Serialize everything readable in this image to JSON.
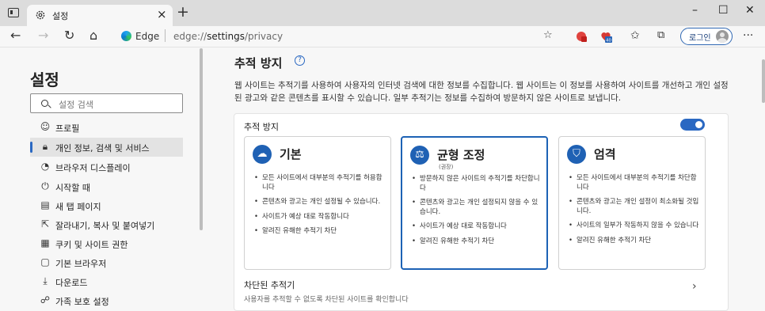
{
  "tab": {
    "title": "설정",
    "close": "×",
    "new_tab": "+"
  },
  "window_controls": {
    "minimize": "–",
    "maximize": "☐",
    "close": "✕"
  },
  "toolbar": {
    "back": "←",
    "forward": "→",
    "refresh": "↻",
    "home": "⌂",
    "edge_label": "Edge",
    "url_prefix": "edge://",
    "url_path": "settings",
    "url_suffix": "/privacy",
    "ext_badge": "40",
    "login": "로그인",
    "more": "···"
  },
  "sidebar": {
    "title": "설정",
    "search_placeholder": "설정 검색",
    "items": [
      {
        "label": "프로필",
        "icon": "profile-icon"
      },
      {
        "label": "개인 정보, 검색 및 서비스",
        "icon": "lock-icon"
      },
      {
        "label": "브라우저 디스플레이",
        "icon": "palette-icon"
      },
      {
        "label": "시작할 때",
        "icon": "power-icon"
      },
      {
        "label": "새 탭 페이지",
        "icon": "new-tab-page-icon"
      },
      {
        "label": "잘라내기, 복사 및 붙여넣기",
        "icon": "share-icon"
      },
      {
        "label": "쿠키 및 사이트 권한",
        "icon": "cookie-icon"
      },
      {
        "label": "기본 브라우저",
        "icon": "browser-icon"
      },
      {
        "label": "다운로드",
        "icon": "download-icon"
      },
      {
        "label": "가족 보호 설정",
        "icon": "family-icon"
      }
    ]
  },
  "main": {
    "title": "추적 방지",
    "help": "?",
    "description": "웹 사이트는 추적기를 사용하여 사용자의 인터넷 검색에 대한 정보를 수집합니다. 웹 사이트는 이 정보를 사용하여 사이트를 개선하고 개인 설정된 광고와 같은 콘텐츠를 표시할 수 있습니다. 일부 추적기는 정보를 수집하여 방문하지 않은 사이트로 보냅니다.",
    "panel_label": "추적 방지",
    "toggle_on": true,
    "cards": [
      {
        "title": "기본",
        "subtitle": "",
        "icon": "basic-icon",
        "bullets": [
          "모든 사이트에서 대부분의 추적기를 허용합니다",
          "콘텐츠와 광고는 개인 설정될 수 있습니다.",
          "사이트가 예상 대로 작동합니다",
          "알려진 유해한 추적기 차단"
        ]
      },
      {
        "title": "균형 조정",
        "subtitle": "(권장)",
        "icon": "balanced-scale-icon",
        "bullets": [
          "방문하지 않은 사이트의 추적기를 차단합니다",
          "콘텐츠와 광고는 개인 설정되지 않을 수 있습니다.",
          "사이트가 예상 대로 작동합니다",
          "알려진 유해한 추적기 차단"
        ]
      },
      {
        "title": "엄격",
        "subtitle": "",
        "icon": "strict-shield-icon",
        "bullets": [
          "모든 사이트에서 대부분의 추적기를 차단합니다",
          "콘텐츠와 광고는 개인 설정이 최소화될 것입니다.",
          "사이트의 일부가 작동하지 않을 수 있습니다",
          "알려진 유해한 추적기 차단"
        ]
      }
    ],
    "blocked": {
      "title": "차단된 추적기",
      "subtitle": "사용자를 추적할 수 없도록 차단된 사이트를 확인합니다"
    }
  },
  "colors": {
    "accent": "#2a68c2",
    "selected_border": "#1d62b5",
    "icon_circle": "#1f61b4"
  }
}
